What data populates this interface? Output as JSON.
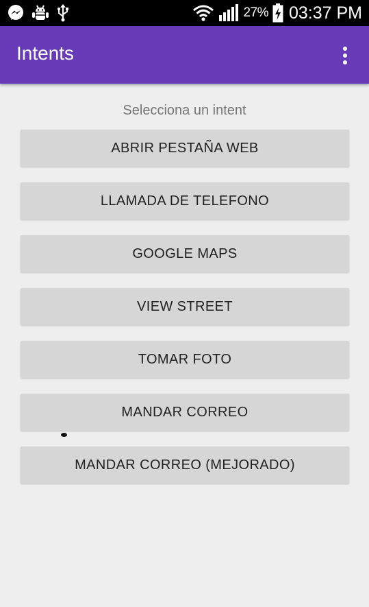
{
  "status_bar": {
    "battery_percent": "27%",
    "time": "03:37 PM",
    "icons": [
      "messenger-icon",
      "android-debug-icon",
      "usb-icon",
      "wifi-icon",
      "signal-icon",
      "battery-charging-icon"
    ]
  },
  "app_bar": {
    "title": "Intents",
    "menu_icon": "overflow-menu-icon",
    "color": "#673ab7"
  },
  "main": {
    "prompt": "Selecciona un intent",
    "buttons": [
      "ABRIR PESTAÑA WEB",
      "LLAMADA DE TELEFONO",
      "GOOGLE MAPS",
      "VIEW STREET",
      "TOMAR FOTO",
      "MANDAR CORREO",
      "MANDAR CORREO (MEJORADO)"
    ]
  }
}
